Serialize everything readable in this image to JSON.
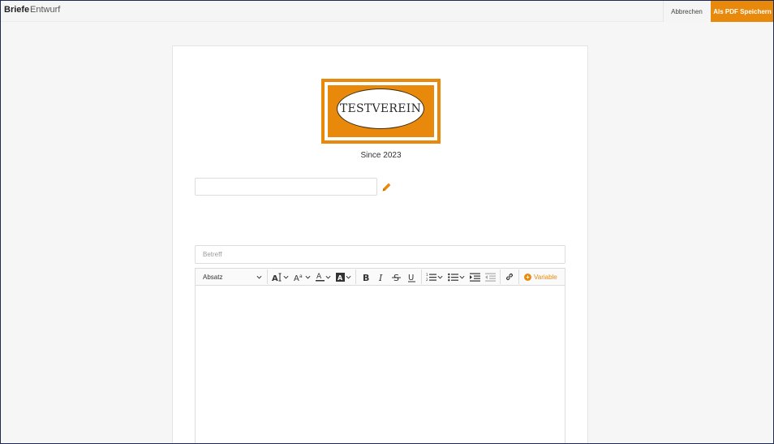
{
  "header": {
    "title": "Briefe",
    "subtitle": "Entwurf",
    "cancel_label": "Abbrechen",
    "save_label": "Als PDF Speichern"
  },
  "letter": {
    "logo_text": "TESTVEREIN",
    "since_text": "Since 2023",
    "name_value": "",
    "subject_placeholder": "Betreff",
    "subject_value": ""
  },
  "toolbar": {
    "paragraph_select": "Absatz",
    "variable_label": "Variable"
  },
  "colors": {
    "accent": "#e8890c",
    "border": "#1c2a55"
  },
  "icons": {
    "edit": "pencil-icon",
    "font_size": "font-size-icon",
    "font_family": "font-family-icon",
    "font_color": "font-color-icon",
    "highlight": "highlight-icon",
    "bold": "bold-icon",
    "italic": "italic-icon",
    "strikethrough": "strikethrough-icon",
    "underline": "underline-icon",
    "numbered_list": "numbered-list-icon",
    "bullet_list": "bullet-list-icon",
    "indent": "indent-icon",
    "outdent": "outdent-icon",
    "link": "link-icon",
    "variable": "plus-circle-icon"
  }
}
